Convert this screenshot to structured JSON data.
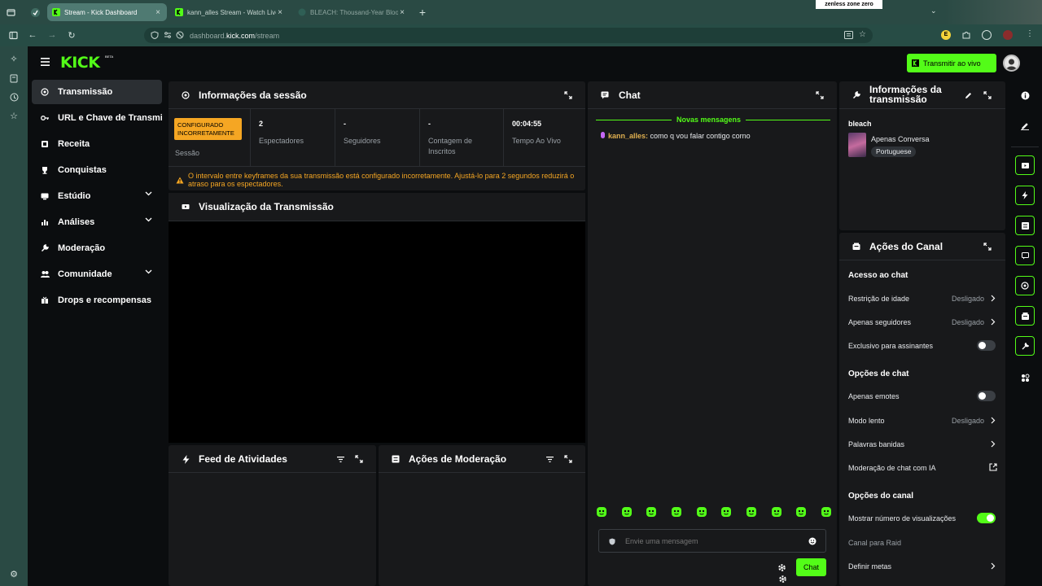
{
  "browser": {
    "tabs": [
      {
        "title": "Stream - Kick Dashboard",
        "active": true
      },
      {
        "title": "kann_alles Stream - Watch Live",
        "active": false
      },
      {
        "title": "BLEACH: Thousand-Year Blood",
        "active": false
      }
    ],
    "url_prefix": "dashboard.",
    "url_domain": "kick.com",
    "url_path": "/stream",
    "promo_badge": "zenless zone zero"
  },
  "header": {
    "logo": "KICK",
    "logo_badge": "BETA",
    "go_live_label": "Transmitir ao vivo"
  },
  "sidebar": {
    "items": [
      {
        "label": "Transmissão",
        "icon": "broadcast-icon",
        "active": true,
        "expandable": false
      },
      {
        "label": "URL e Chave de Transmissão",
        "icon": "key-icon",
        "active": false,
        "expandable": false
      },
      {
        "label": "Receita",
        "icon": "revenue-icon",
        "active": false,
        "expandable": false
      },
      {
        "label": "Conquistas",
        "icon": "trophy-icon",
        "active": false,
        "expandable": false
      },
      {
        "label": "Estúdio",
        "icon": "studio-icon",
        "active": false,
        "expandable": true
      },
      {
        "label": "Análises",
        "icon": "analytics-icon",
        "active": false,
        "expandable": true
      },
      {
        "label": "Moderação",
        "icon": "wrench-icon",
        "active": false,
        "expandable": false
      },
      {
        "label": "Comunidade",
        "icon": "community-icon",
        "active": false,
        "expandable": true
      },
      {
        "label": "Drops e recompensas",
        "icon": "gift-icon",
        "active": false,
        "expandable": false
      }
    ]
  },
  "session": {
    "title": "Informações da sessão",
    "status_badge": "CONFIGURADO INCORRETAMENTE",
    "status_label": "Sessão",
    "stats": [
      {
        "value": "2",
        "label": "Espectadores"
      },
      {
        "value": "-",
        "label": "Seguidores"
      },
      {
        "value": "-",
        "label": "Contagem de Inscritos"
      },
      {
        "value": "00:04:55",
        "label": "Tempo Ao Vivo"
      }
    ],
    "warning": "O intervalo entre keyframes da sua transmissão está configurado incorretamente. Ajustá-lo para 2 segundos reduzirá o atraso para os espectadores."
  },
  "preview": {
    "title": "Visualização da Transmissão"
  },
  "activity": {
    "title": "Feed de Atividades"
  },
  "mod_actions": {
    "title": "Ações de Moderação"
  },
  "chat": {
    "title": "Chat",
    "new_messages": "Novas mensagens",
    "messages": [
      {
        "user": "kann_alles:",
        "text": "como q vou falar contigo corno"
      }
    ],
    "input_placeholder": "Envie uma mensagem",
    "send_label": "Chat",
    "emote_count": 10
  },
  "stream_info": {
    "title": "Informações da transmissão",
    "stream_title": "bleach",
    "category": "Apenas Conversa",
    "language": "Portuguese"
  },
  "channel_actions": {
    "title": "Ações do Canal",
    "chat_access": {
      "title": "Acesso ao chat",
      "age_restriction": {
        "label": "Restrição de idade",
        "value": "Desligado"
      },
      "followers_only": {
        "label": "Apenas seguidores",
        "value": "Desligado"
      },
      "subscribers_only": {
        "label": "Exclusivo para assinantes",
        "enabled": false
      }
    },
    "chat_options": {
      "title": "Opções de chat",
      "emotes_only": {
        "label": "Apenas emotes",
        "enabled": false
      },
      "slow_mode": {
        "label": "Modo lento",
        "value": "Desligado"
      },
      "banned_words": {
        "label": "Palavras banidas"
      },
      "ai_moderation": {
        "label": "Moderação de chat com IA"
      }
    },
    "channel_options": {
      "title": "Opções do canal",
      "show_views": {
        "label": "Mostrar número de visualizações",
        "enabled": true
      },
      "raid_channel": {
        "label": "Canal para Raid"
      },
      "set_goals": {
        "label": "Definir metas"
      }
    }
  },
  "colors": {
    "accent": "#53fc18",
    "panel": "#18191b",
    "background": "#0b0d0f",
    "warning": "#f5a623",
    "badge": "#f5a623",
    "browser": "#2a4a44"
  }
}
